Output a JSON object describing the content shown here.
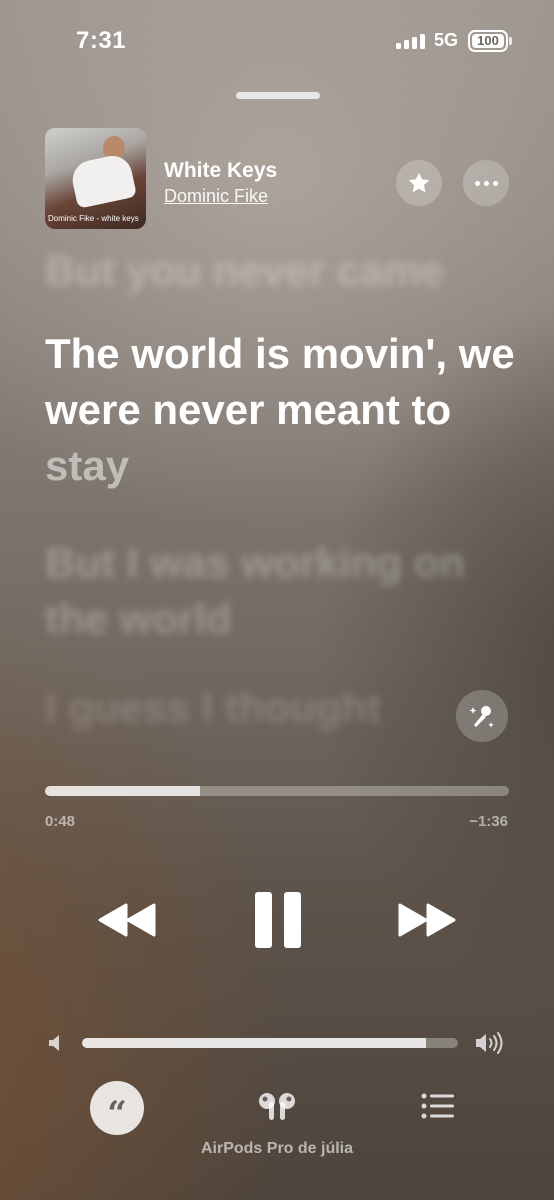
{
  "status_bar": {
    "time": "7:31",
    "network": "5G",
    "battery": "100",
    "signal_icon": "cellular-signal-icon"
  },
  "now_playing": {
    "title": "White Keys",
    "artist": "Dominic Fike",
    "artwork_caption": "Dominic Fike - white keys",
    "favorite_icon": "star-icon",
    "more_icon": "ellipsis-icon"
  },
  "lyrics": {
    "previous": "But you never came",
    "current_sung": "The world is movin', we were never meant to ",
    "current_upcoming": "stay",
    "next": "But I was working on the world",
    "after": "I guess I thought",
    "sing_icon": "microphone-sparkle-icon"
  },
  "playback": {
    "elapsed": "0:48",
    "remaining": "−1:36",
    "progress": 0.335,
    "rewind_icon": "rewind-icon",
    "pause_icon": "pause-icon",
    "forward_icon": "fast-forward-icon"
  },
  "volume": {
    "level": 0.915,
    "low_icon": "speaker-low-icon",
    "high_icon": "speaker-high-icon"
  },
  "bottom_bar": {
    "lyrics_icon": "lyrics-quote-icon",
    "airplay_icon": "airpods-icon",
    "queue_icon": "queue-list-icon",
    "output_device": "AirPods Pro de júlia"
  },
  "colors": {
    "background_top": "#9b948e",
    "background_bottom": "#4d443c",
    "text": "#ffffff"
  }
}
